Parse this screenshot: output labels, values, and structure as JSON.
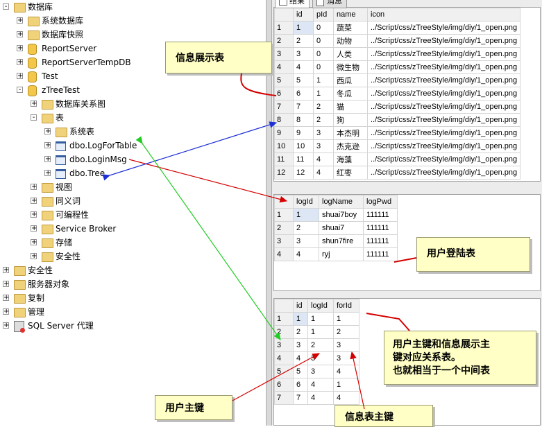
{
  "tree": {
    "items": [
      {
        "label": "数据库",
        "icon": "folder-icon",
        "expand": "-"
      },
      {
        "label": "系统数据库",
        "icon": "folder-icon",
        "expand": "+"
      },
      {
        "label": "数据库快照",
        "icon": "folder-icon",
        "expand": "+"
      },
      {
        "label": "ReportServer",
        "icon": "database-icon",
        "expand": "+"
      },
      {
        "label": "ReportServerTempDB",
        "icon": "database-icon",
        "expand": "+"
      },
      {
        "label": "Test",
        "icon": "database-icon",
        "expand": "+"
      },
      {
        "label": "zTreeTest",
        "icon": "database-icon",
        "expand": "-"
      },
      {
        "label": "数据库关系图",
        "icon": "folder-icon",
        "expand": "+"
      },
      {
        "label": "表",
        "icon": "folder-icon",
        "expand": "-"
      },
      {
        "label": "系统表",
        "icon": "folder-icon",
        "expand": "+"
      },
      {
        "label": "dbo.LogForTable",
        "icon": "table-icon",
        "expand": "+"
      },
      {
        "label": "dbo.LoginMsg",
        "icon": "table-icon",
        "expand": "+"
      },
      {
        "label": "dbo.Tree",
        "icon": "table-icon",
        "expand": "+"
      },
      {
        "label": "视图",
        "icon": "folder-icon",
        "expand": "+"
      },
      {
        "label": "同义词",
        "icon": "folder-icon",
        "expand": "+"
      },
      {
        "label": "可编程性",
        "icon": "folder-icon",
        "expand": "+"
      },
      {
        "label": "Service Broker",
        "icon": "folder-icon",
        "expand": "+"
      },
      {
        "label": "存储",
        "icon": "folder-icon",
        "expand": "+"
      },
      {
        "label": "安全性",
        "icon": "folder-icon",
        "expand": "+"
      },
      {
        "label": "安全性",
        "icon": "folder-icon",
        "expand": "+"
      },
      {
        "label": "服务器对象",
        "icon": "folder-icon",
        "expand": "+"
      },
      {
        "label": "复制",
        "icon": "folder-icon",
        "expand": "+"
      },
      {
        "label": "管理",
        "icon": "folder-icon",
        "expand": "+"
      },
      {
        "label": "SQL Server 代理",
        "icon": "sql-agent-icon",
        "expand": "+"
      }
    ]
  },
  "tabs": {
    "results": "结果",
    "messages": "消息"
  },
  "grid1": {
    "headers": [
      "id",
      "pId",
      "name",
      "icon"
    ],
    "rows": [
      [
        "1",
        "1",
        "0",
        "蔬菜",
        "../Script/css/zTreeStyle/img/diy/1_open.png"
      ],
      [
        "2",
        "2",
        "0",
        "动物",
        "../Script/css/zTreeStyle/img/diy/1_open.png"
      ],
      [
        "3",
        "3",
        "0",
        "人类",
        "../Script/css/zTreeStyle/img/diy/1_open.png"
      ],
      [
        "4",
        "4",
        "0",
        "微生物",
        "../Script/css/zTreeStyle/img/diy/1_open.png"
      ],
      [
        "5",
        "5",
        "1",
        "西瓜",
        "../Script/css/zTreeStyle/img/diy/1_open.png"
      ],
      [
        "6",
        "6",
        "1",
        "冬瓜",
        "../Script/css/zTreeStyle/img/diy/1_open.png"
      ],
      [
        "7",
        "7",
        "2",
        "猫",
        "../Script/css/zTreeStyle/img/diy/1_open.png"
      ],
      [
        "8",
        "8",
        "2",
        "狗",
        "../Script/css/zTreeStyle/img/diy/1_open.png"
      ],
      [
        "9",
        "9",
        "3",
        "本杰明",
        "../Script/css/zTreeStyle/img/diy/1_open.png"
      ],
      [
        "10",
        "10",
        "3",
        "杰克逊",
        "../Script/css/zTreeStyle/img/diy/1_open.png"
      ],
      [
        "11",
        "11",
        "4",
        "海藻",
        "../Script/css/zTreeStyle/img/diy/1_open.png"
      ],
      [
        "12",
        "12",
        "4",
        "红枣",
        "../Script/css/zTreeStyle/img/diy/1_open.png"
      ]
    ]
  },
  "grid2": {
    "headers": [
      "logId",
      "logName",
      "logPwd"
    ],
    "rows": [
      [
        "1",
        "1",
        "shuai7boy",
        "111111"
      ],
      [
        "2",
        "2",
        "shuai7",
        "111111"
      ],
      [
        "3",
        "3",
        "shun7fire",
        "111111"
      ],
      [
        "4",
        "4",
        "ryj",
        "111111"
      ]
    ]
  },
  "grid3": {
    "headers": [
      "id",
      "logId",
      "forId"
    ],
    "rows": [
      [
        "1",
        "1",
        "1",
        "1"
      ],
      [
        "2",
        "2",
        "1",
        "2"
      ],
      [
        "3",
        "3",
        "2",
        "3"
      ],
      [
        "4",
        "4",
        "3",
        "3"
      ],
      [
        "5",
        "5",
        "3",
        "4"
      ],
      [
        "6",
        "6",
        "4",
        "1"
      ],
      [
        "7",
        "7",
        "4",
        "4"
      ]
    ]
  },
  "notes": {
    "info_table": "信息展示表",
    "user_login_table": "用户登陆表",
    "mapping_table": "用户主键和信息展示主\n键对应关系表。\n也就相当于一个中间表",
    "user_pk": "用户主键",
    "info_pk": "信息表主键"
  },
  "colors": {
    "note_bg": "#ffffc6",
    "arrow_red": "#d40000",
    "arrow_blue": "#1d2fd6",
    "arrow_green": "#22cc22"
  }
}
